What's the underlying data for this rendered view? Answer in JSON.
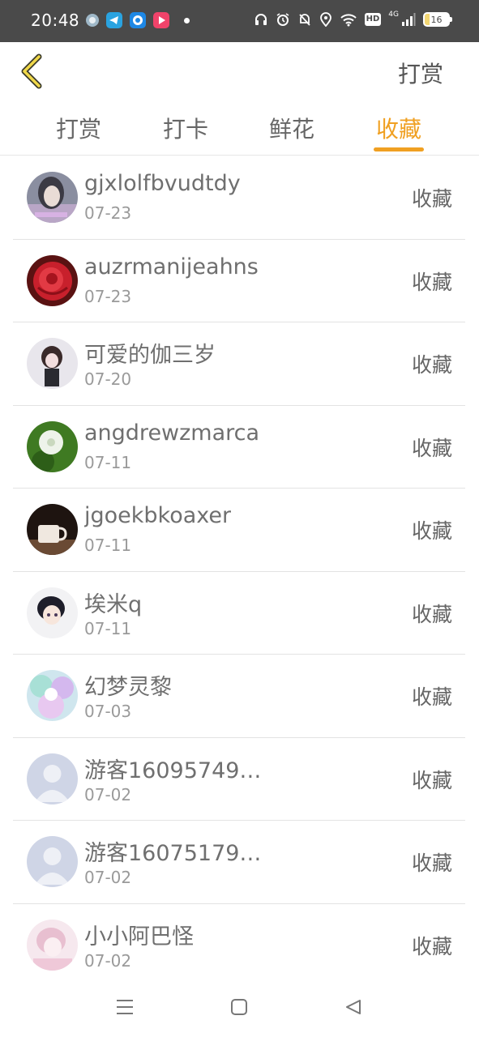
{
  "status_bar": {
    "time": "20:48",
    "battery": "16",
    "network": "4G",
    "hd": "HD",
    "app_icons": [
      "cloud-app-icon",
      "telegram-icon",
      "chrome-app-icon",
      "video-app-icon"
    ]
  },
  "header": {
    "action_label": "打赏"
  },
  "tabs": [
    {
      "label": "打赏",
      "active": false
    },
    {
      "label": "打卡",
      "active": false
    },
    {
      "label": "鲜花",
      "active": false
    },
    {
      "label": "收藏",
      "active": true
    }
  ],
  "list": [
    {
      "name": "gjxlolfbvudtdy",
      "date": "07-23",
      "action": "收藏",
      "avatar": "girl-photo-avatar"
    },
    {
      "name": "auzrmanijeahns",
      "date": "07-23",
      "action": "收藏",
      "avatar": "rose-avatar"
    },
    {
      "name": "可爱的伽三岁",
      "date": "07-20",
      "action": "收藏",
      "avatar": "anime-girl-avatar"
    },
    {
      "name": "angdrewzmarca",
      "date": "07-11",
      "action": "收藏",
      "avatar": "dandelion-avatar"
    },
    {
      "name": "jgoekbkoaxer",
      "date": "07-11",
      "action": "收藏",
      "avatar": "coffee-cup-avatar"
    },
    {
      "name": "埃米q",
      "date": "07-11",
      "action": "收藏",
      "avatar": "anime-boy-avatar"
    },
    {
      "name": "幻梦灵黎",
      "date": "07-03",
      "action": "收藏",
      "avatar": "holographic-avatar"
    },
    {
      "name": "游客16095749…",
      "date": "07-02",
      "action": "收藏",
      "avatar": "default-user-avatar"
    },
    {
      "name": "游客16075179…",
      "date": "07-02",
      "action": "收藏",
      "avatar": "default-user-avatar"
    },
    {
      "name": "小小阿巴怪",
      "date": "07-02",
      "action": "收藏",
      "avatar": "pink-anime-avatar"
    }
  ],
  "colors": {
    "accent": "#f0a022",
    "status_bar": "#4a4a4a",
    "text_primary": "#6f6f6f",
    "text_secondary": "#9a9a9a"
  }
}
